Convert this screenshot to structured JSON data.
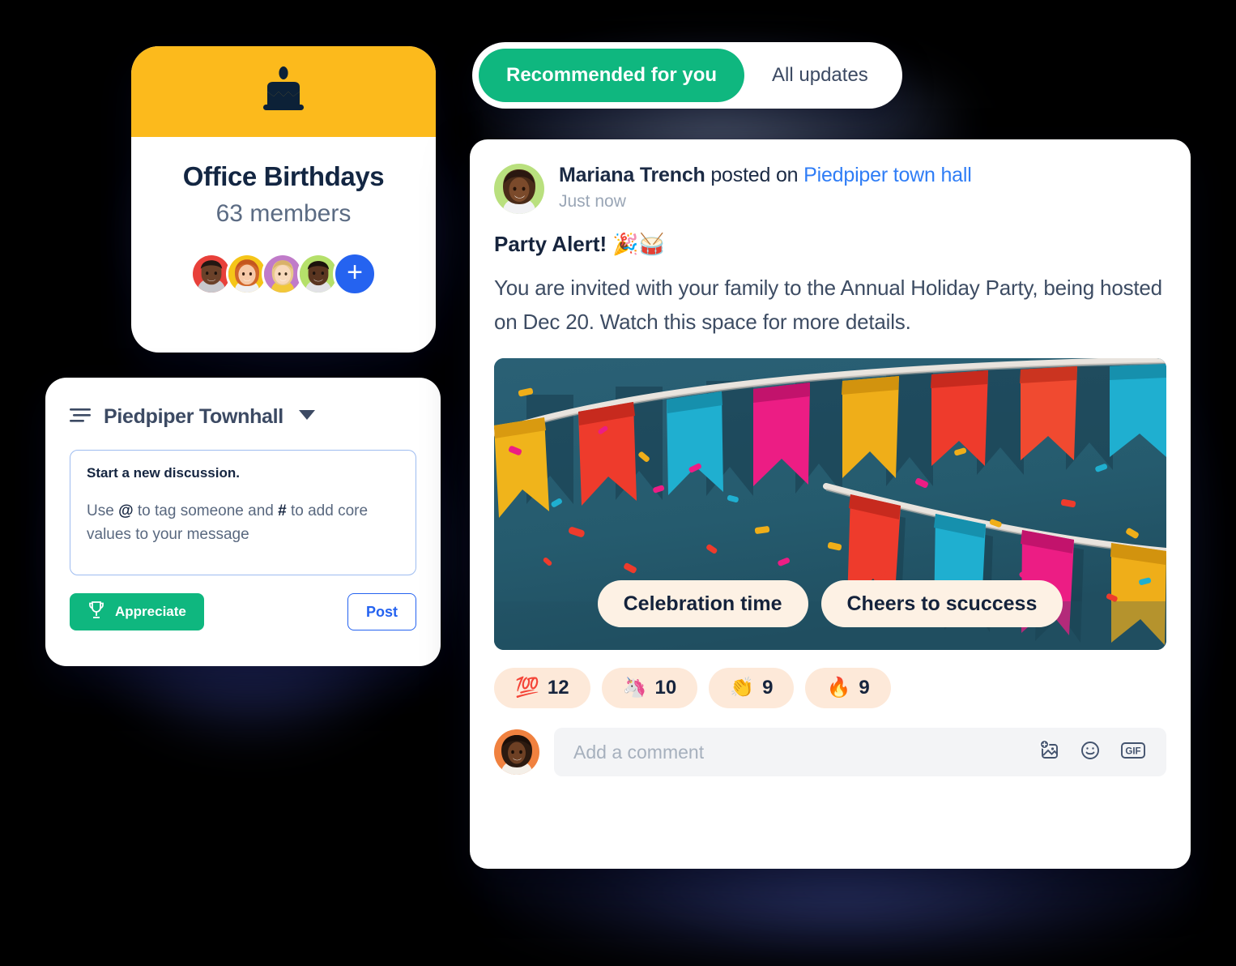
{
  "theme": {
    "accent_green": "#0FB77F",
    "accent_blue": "#2563f0",
    "link_blue": "#2f7df6",
    "banner_yellow": "#FCBA1C",
    "banner_teal": "#255B6E",
    "chip_cream": "#FDF1E4",
    "reaction_peach": "#FDE9D9",
    "text_dark": "#16243d"
  },
  "tabs": {
    "active_label": "Recommended for you",
    "inactive_label": "All updates"
  },
  "birthday_card": {
    "icon": "birthday-cake-icon",
    "title": "Office Birthdays",
    "members": "63 members",
    "add_label": "+",
    "avatars": [
      {
        "name": "member-avatar-1",
        "bg": "#E8403A"
      },
      {
        "name": "member-avatar-2",
        "bg": "#F5C518"
      },
      {
        "name": "member-avatar-3",
        "bg": "#C07BC9"
      },
      {
        "name": "member-avatar-4",
        "bg": "#B5E06A"
      }
    ]
  },
  "townhall_card": {
    "menu_icon": "list-lines-icon",
    "title": "Piedpiper Townhall",
    "caret_icon": "chevron-down-icon",
    "composer": {
      "heading": "Start a new discussion.",
      "hint_pre": "Use ",
      "hint_at": "@",
      "hint_mid": " to tag someone and ",
      "hint_hash": "#",
      "hint_post": " to add core values to your message"
    },
    "appreciate_label": "Appreciate",
    "appreciate_icon": "trophy-icon",
    "post_label": "Post"
  },
  "post": {
    "author": "Mariana Trench",
    "action": " posted on ",
    "channel": "Piedpiper town hall",
    "timestamp": "Just now",
    "title": "Party Alert! 🎉🥁",
    "body": "You are invited with your family to the Annual Holiday Party, being hosted on Dec 20. Watch this space for more details.",
    "banner": {
      "alt": "party-bunting-confetti-image",
      "chips": [
        {
          "name": "banner-chip-celebration",
          "label": "Celebration time"
        },
        {
          "name": "banner-chip-cheers",
          "label": "Cheers to scuccess"
        }
      ]
    },
    "reactions": [
      {
        "name": "reaction-hundred",
        "emoji": "💯",
        "count": "12"
      },
      {
        "name": "reaction-unicorn",
        "emoji": "🦄",
        "count": "10"
      },
      {
        "name": "reaction-clap",
        "emoji": "👏",
        "count": "9"
      },
      {
        "name": "reaction-fire",
        "emoji": "🔥",
        "count": "9"
      }
    ],
    "comment": {
      "placeholder": "Add a comment",
      "icons": [
        {
          "name": "add-image-icon",
          "label": ""
        },
        {
          "name": "emoji-smiley-icon",
          "label": ""
        },
        {
          "name": "gif-icon",
          "label": "GIF"
        }
      ]
    }
  }
}
